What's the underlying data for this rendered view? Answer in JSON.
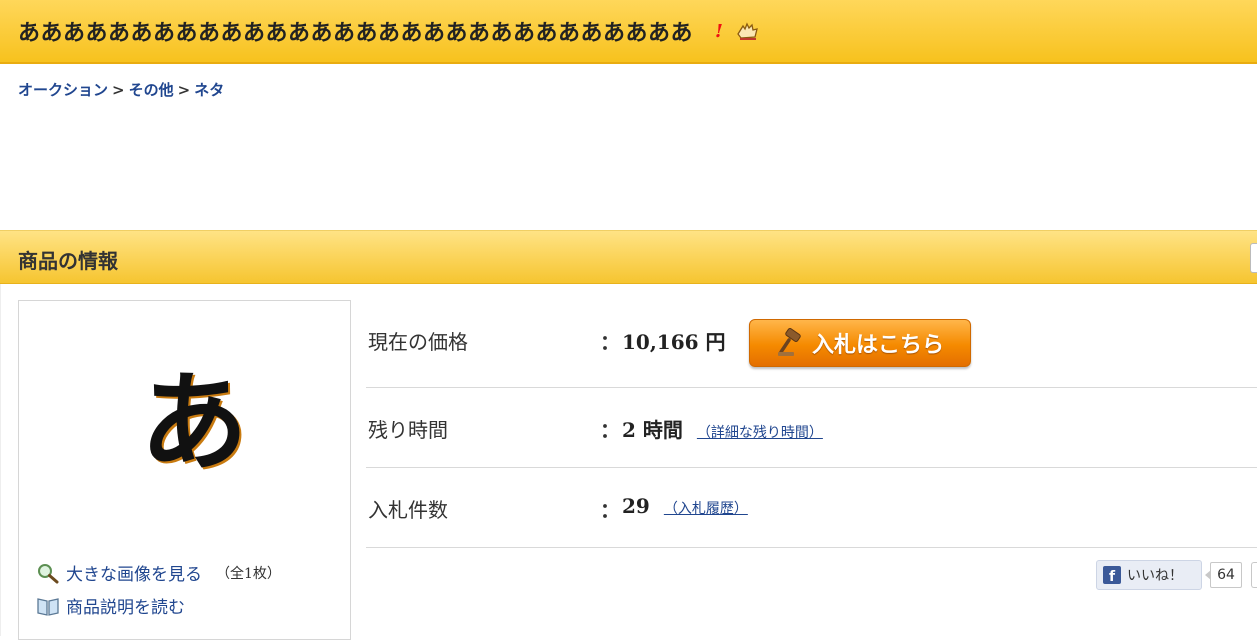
{
  "header": {
    "title": "ああああああああああああああああああああああああああああああ",
    "icons": [
      "exclamation-icon",
      "hand-icon"
    ]
  },
  "breadcrumb": {
    "items": [
      "オークション",
      "その他",
      "ネタ"
    ],
    "separator": ">"
  },
  "section": {
    "title": "商品の情報"
  },
  "product_image": {
    "glyph": "あ",
    "view_large_label": "大きな画像を見る",
    "view_large_count": "（全1枚）",
    "read_description_label": "商品説明を読む"
  },
  "info": {
    "rows": [
      {
        "label": "現在の価格",
        "colon": "：",
        "value": "10,166 円",
        "sub": ""
      },
      {
        "label": "残り時間",
        "colon": "：",
        "value": "2 時間",
        "sub": "（詳細な残り時間）"
      },
      {
        "label": "入札件数",
        "colon": "：",
        "value": "29",
        "sub": "（入札履歴）"
      }
    ],
    "bid_button_label": "入札はこちら"
  },
  "social": {
    "like_label": "いいね！",
    "like_count": "64"
  },
  "colors": {
    "header_yellow": "#f7c21e",
    "link_blue": "#20468f",
    "bid_orange": "#f58a00",
    "facebook_blue": "#3b5998"
  }
}
